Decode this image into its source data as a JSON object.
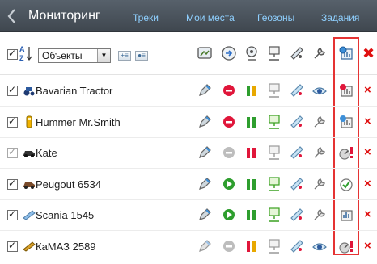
{
  "header": {
    "title": "Мониторинг",
    "nav": [
      "Треки",
      "Мои места",
      "Геозоны",
      "Задания"
    ]
  },
  "toolbar": {
    "select_value": "Объекты",
    "delete_glyph": "✖"
  },
  "rows": [
    {
      "name": "Bavarian Tractor",
      "checked": true
    },
    {
      "name": "Hummer Mr.Smith",
      "checked": true
    },
    {
      "name": "Kate",
      "checked": true
    },
    {
      "name": "Peugout 6534",
      "checked": true
    },
    {
      "name": "Scania 1545",
      "checked": true
    },
    {
      "name": "КаМАЗ 2589",
      "checked": true
    }
  ],
  "row_delete_glyph": "×",
  "colors": {
    "topbar": "#4a535c",
    "nav_link": "#8fd0ff",
    "highlight_box": "#e53333",
    "delete": "#e01010"
  }
}
